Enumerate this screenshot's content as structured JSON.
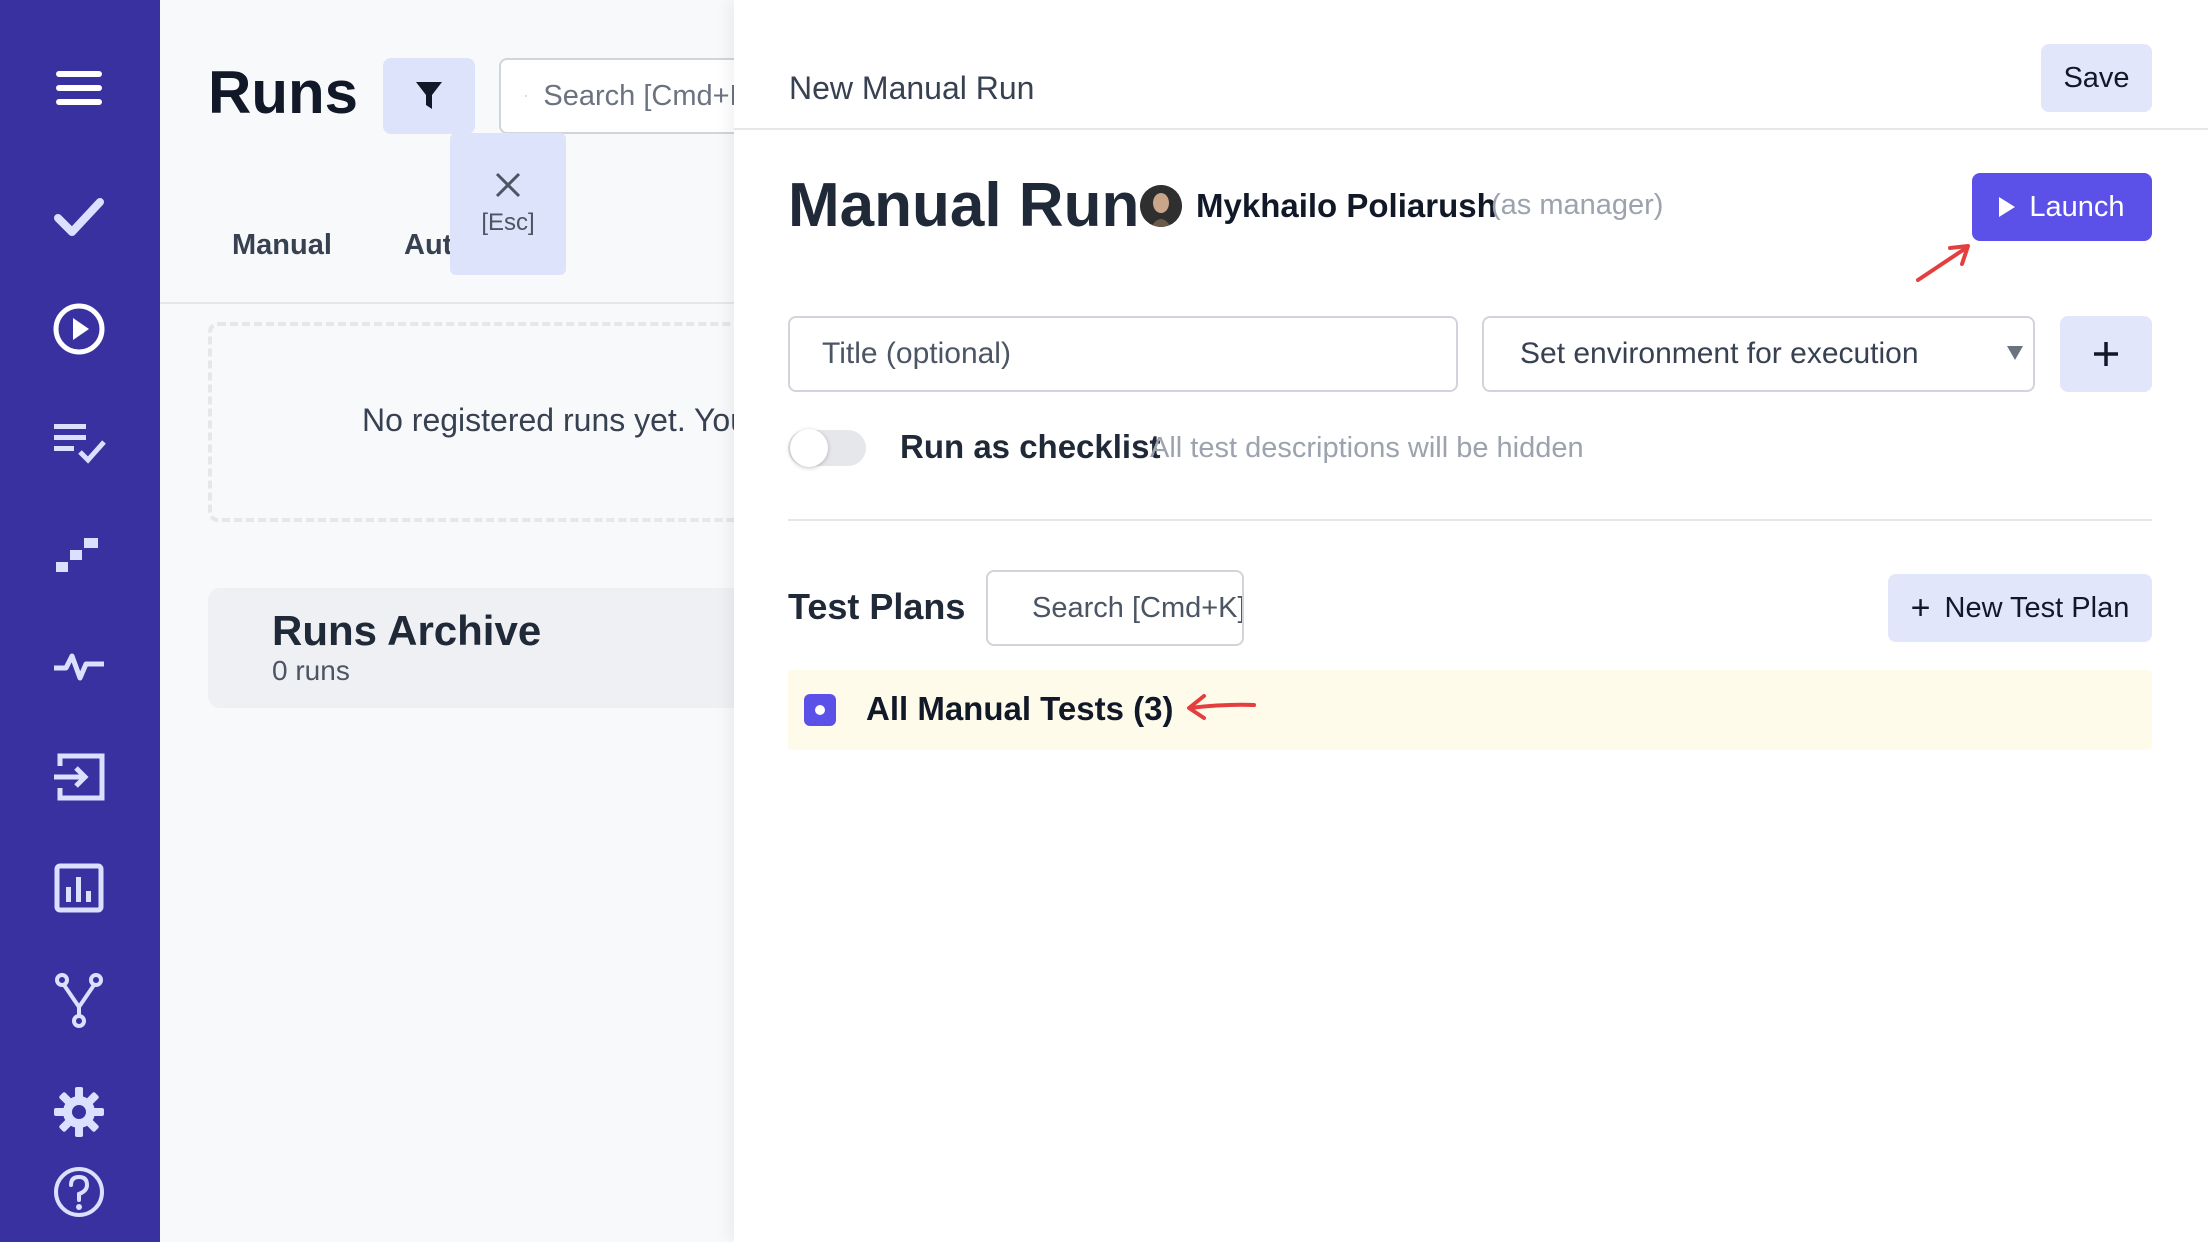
{
  "sidebar": {
    "items": [
      {
        "icon": "menu-icon"
      },
      {
        "icon": "checkmark-icon"
      },
      {
        "icon": "play-circle-icon"
      },
      {
        "icon": "list-check-icon"
      },
      {
        "icon": "steps-icon"
      },
      {
        "icon": "pulse-icon"
      },
      {
        "icon": "import-icon"
      },
      {
        "icon": "analytics-icon"
      },
      {
        "icon": "branch-icon"
      },
      {
        "icon": "gear-icon"
      },
      {
        "icon": "help-icon"
      }
    ],
    "background": "#3a31a0"
  },
  "runs": {
    "title": "Runs",
    "search_placeholder": "Search [Cmd+K]",
    "close_label": "[Esc]",
    "tabs": [
      "Manual",
      "Automated"
    ],
    "empty_text": "No registered runs yet. You",
    "archive": {
      "title": "Runs Archive",
      "count": "0 runs"
    }
  },
  "panel": {
    "header_title": "New Manual Run",
    "save_label": "Save",
    "run_title": "Manual Run",
    "user_name": "Mykhailo Poliarush",
    "user_role": "(as manager)",
    "launch_label": "Launch",
    "title_placeholder": "Title (optional)",
    "environment_placeholder": "Set environment for execution",
    "checklist_label": "Run as checklist",
    "checklist_hint": "All test descriptions will be hidden",
    "test_plans_label": "Test Plans",
    "plans_search_placeholder": "Search [Cmd+K]",
    "new_plan_label": "New Test Plan",
    "plans": [
      {
        "label": "All Manual Tests (3)",
        "selected": true
      }
    ]
  },
  "colors": {
    "accent": "#5b50e8",
    "annotation_arrow": "#e53e3e"
  }
}
